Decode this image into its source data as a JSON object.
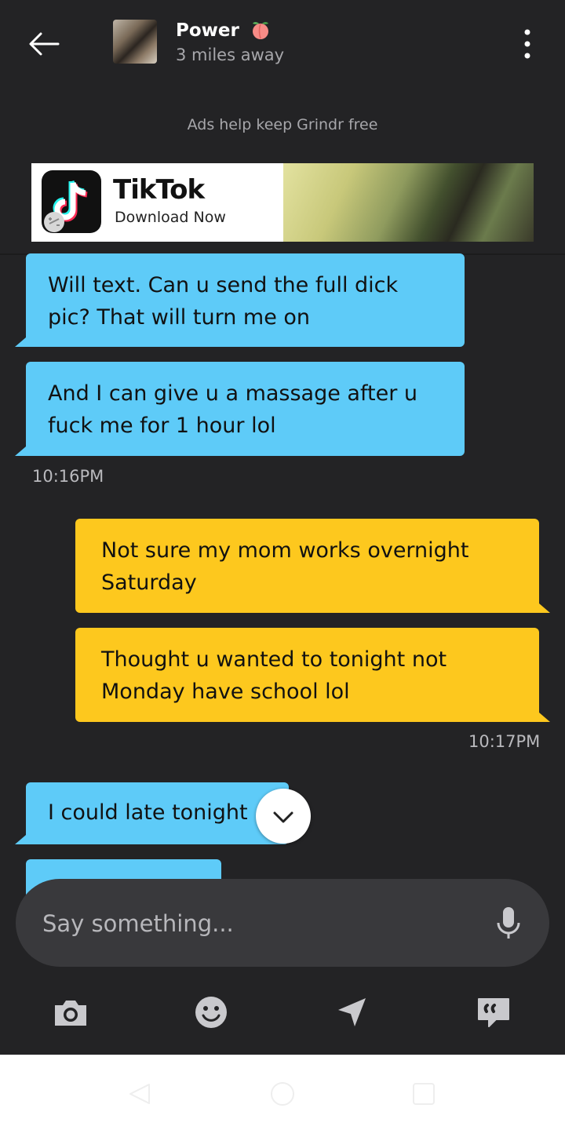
{
  "header": {
    "name": "Power",
    "distance": "3 miles away"
  },
  "ads": {
    "note": "Ads help keep Grindr free",
    "banner_title": "TikTok",
    "banner_subtitle": "Download Now"
  },
  "messages": [
    {
      "direction": "in",
      "lines": [
        "Will text. Can u send the full dick",
        "pic? That will turn me on"
      ]
    },
    {
      "direction": "in",
      "lines": [
        "And I can give u a massage after u",
        "fuck me for 1 hour lol"
      ]
    },
    {
      "direction": "out",
      "lines": [
        "Not sure my mom works overnight",
        "Saturday"
      ]
    },
    {
      "direction": "out",
      "lines": [
        "Thought u wanted to tonight not",
        "Monday have school lol"
      ]
    },
    {
      "direction": "in",
      "lines": [
        "I could late tonight"
      ]
    }
  ],
  "timestamps": [
    "10:16PM",
    "10:17PM"
  ],
  "composer": {
    "placeholder": "Say something..."
  },
  "toolbar": [
    "camera-icon",
    "emoji-icon",
    "location-icon",
    "saved-phrases-icon"
  ],
  "colors": {
    "background": "#232325",
    "incoming_bubble": "#5ecbf8",
    "outgoing_bubble": "#fdc81e",
    "composer": "#39393c"
  }
}
